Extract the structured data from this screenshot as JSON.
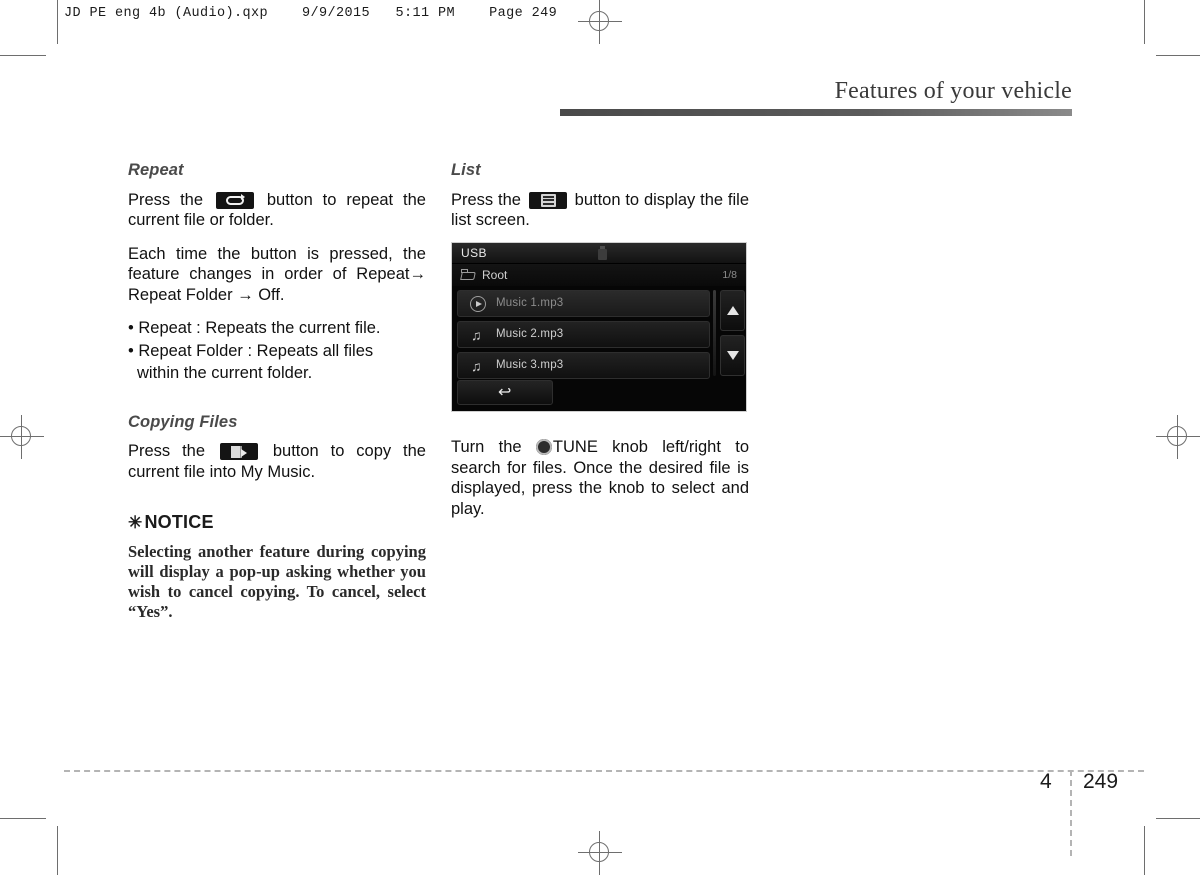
{
  "print_marks": {
    "filestamp": "JD PE eng 4b (Audio).qxp    9/9/2015   5:11 PM    Page 249"
  },
  "header": {
    "title": "Features of your vehicle"
  },
  "left_column": {
    "repeat": {
      "heading": "Repeat",
      "icon": "repeat-icon",
      "para1_before": "Press the",
      "para1_after": "button to repeat the current file or folder.",
      "para2": "Each time the button is pressed, the feature changes in order of Repeat→ Repeat Folder → Off.",
      "bullets": [
        "• Repeat : Repeats the current file.",
        "• Repeat Folder : Repeats all files",
        "within the current folder."
      ]
    },
    "copying": {
      "heading": "Copying Files",
      "icon": "copy-icon",
      "para_before": "Press the",
      "para_after": "button to copy the current file into My Music."
    },
    "notice": {
      "star": "✳",
      "heading": "NOTICE",
      "body": "Selecting another feature during copying will display a pop-up asking whether you wish to cancel copying. To cancel, select “Yes”."
    }
  },
  "right_column": {
    "list": {
      "heading": "List",
      "icon": "list-icon",
      "para_before": "Press the",
      "para_after": "button to display the file list screen."
    },
    "tune_note": {
      "before": "Turn the",
      "knob_icon": "tune-knob-icon",
      "after": "TUNE knob left/right to search for files. Once the desired file is displayed, press the knob to select and play."
    }
  },
  "head_unit_screen": {
    "source_title": "USB",
    "usb_icon": "usb-stick-icon",
    "breadcrumb": {
      "folder_icon": "folder-icon",
      "label": "Root",
      "count": "1/8"
    },
    "files": [
      {
        "name": "Music 1.mp3",
        "icon": "play-icon",
        "state": "playing"
      },
      {
        "name": "Music 2.mp3",
        "icon": "music-note-icon",
        "state": "normal"
      },
      {
        "name": "Music 3.mp3",
        "icon": "music-note-icon",
        "state": "normal"
      }
    ],
    "note_glyph": "♫",
    "scroll_up": "scroll-up-icon",
    "scroll_down": "scroll-down-icon",
    "back_button": "↩"
  },
  "footer": {
    "chapter": "4",
    "page": "249"
  }
}
